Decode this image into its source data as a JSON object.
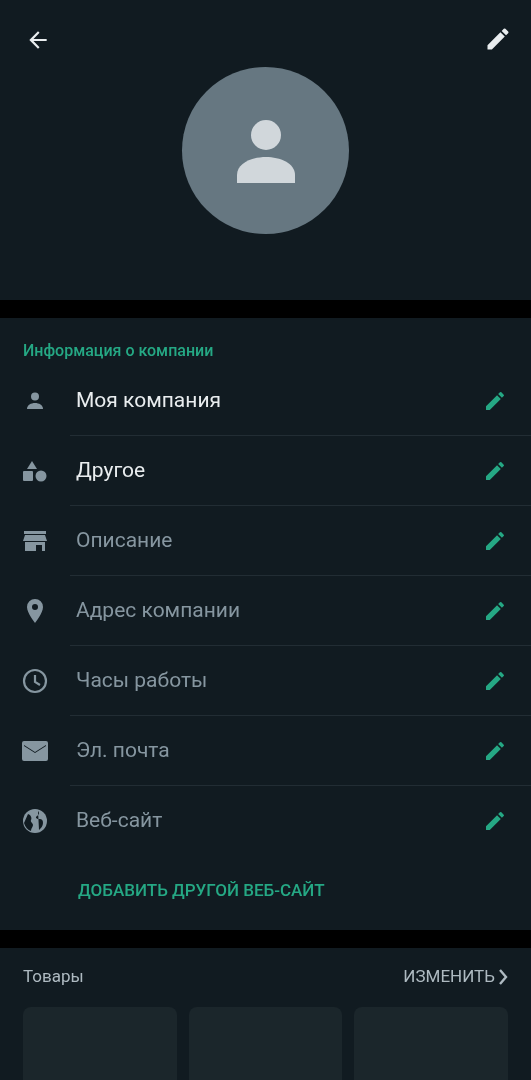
{
  "business_info": {
    "title": "Информация о компании",
    "fields": [
      {
        "kind": "name",
        "value": "Моя компания"
      },
      {
        "kind": "category",
        "value": "Другое"
      },
      {
        "kind": "description",
        "placeholder": "Описание"
      },
      {
        "kind": "address",
        "placeholder": "Адрес компании"
      },
      {
        "kind": "hours",
        "placeholder": "Часы работы"
      },
      {
        "kind": "email",
        "placeholder": "Эл. почта"
      },
      {
        "kind": "website",
        "placeholder": "Веб-сайт"
      }
    ],
    "add_link": "ДОБАВИТЬ ДРУГОЙ ВЕБ-САЙТ"
  },
  "products": {
    "title": "Товары",
    "action": "ИЗМЕНИТЬ",
    "tiles": [
      {
        "kind": "empty"
      },
      {
        "kind": "empty"
      },
      {
        "kind": "empty"
      }
    ]
  }
}
